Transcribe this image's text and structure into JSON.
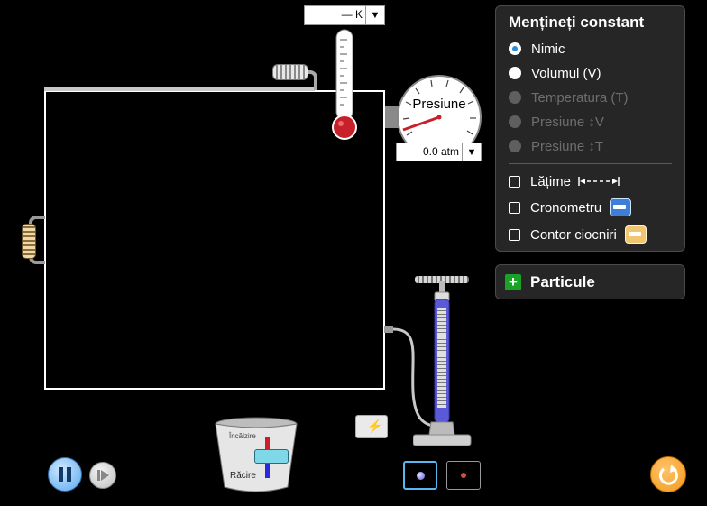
{
  "thermometer": {
    "value": "— K"
  },
  "pressure_gauge": {
    "title": "Presiune",
    "value": "0.0 atm"
  },
  "constant_panel": {
    "title": "Mențineți constant",
    "options": [
      {
        "label": "Nimic",
        "state": "selected"
      },
      {
        "label": "Volumul (V)",
        "state": "enabled"
      },
      {
        "label": "Temperatura (T)",
        "state": "disabled"
      },
      {
        "label": "Presiune ↕V",
        "state": "disabled"
      },
      {
        "label": "Presiune ↕T",
        "state": "disabled"
      }
    ],
    "checks": [
      {
        "label": "Lățime",
        "checked": false,
        "icon": "width-ruler-icon"
      },
      {
        "label": "Cronometru",
        "checked": false,
        "icon": "stopwatch-icon"
      },
      {
        "label": "Contor ciocniri",
        "checked": false,
        "icon": "collision-counter-icon"
      }
    ]
  },
  "particles_panel": {
    "title": "Particule",
    "expand_icon": "plus-icon"
  },
  "bucket": {
    "heat_label": "Încălzire",
    "cool_label": "Răcire"
  },
  "colors": {
    "accent_blue": "#2f8bd8",
    "pump_blue": "#5a5ad8",
    "thermometer_red": "#c8202a",
    "reset_orange": "#f39a1a",
    "panel_bg": "#262626"
  }
}
